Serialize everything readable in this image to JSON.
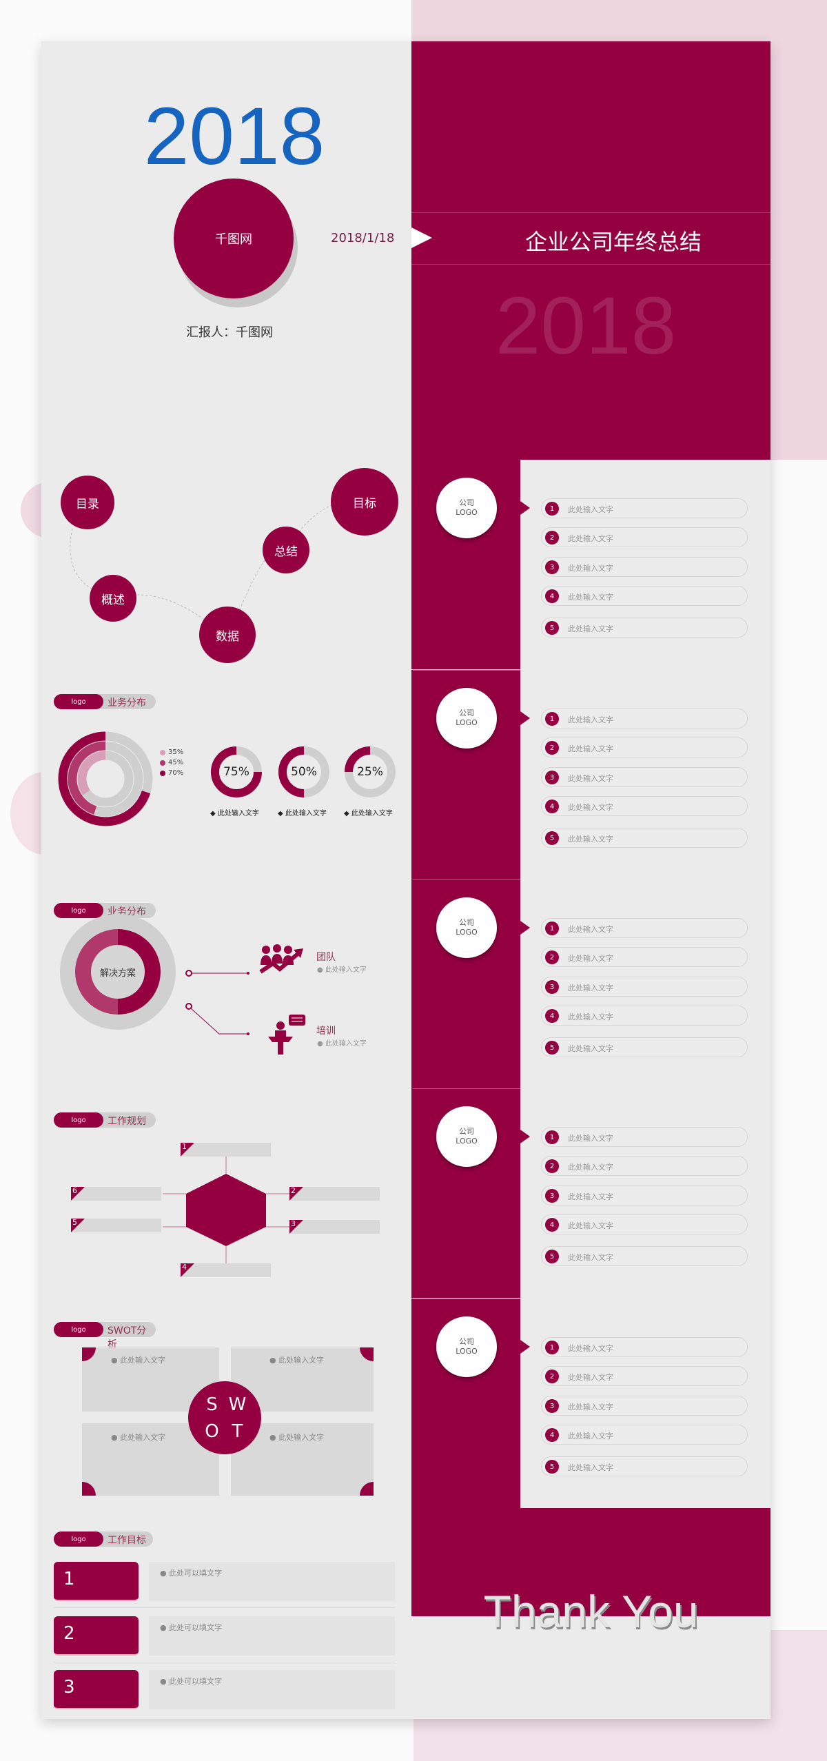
{
  "colors": {
    "accent": "#940040",
    "year_blue": "#1565c0",
    "panel": "#ebebeb"
  },
  "cover": {
    "year": "2018",
    "circle_label": "千图网",
    "date": "2018/1/18",
    "title": "企业公司年终总结",
    "reporter": "汇报人：千图网",
    "faded_year": "2018"
  },
  "toc": {
    "items": [
      "目录",
      "目标",
      "总结",
      "概述",
      "数据"
    ]
  },
  "dist1": {
    "logo": "logo",
    "title": "业务分布",
    "legend": [
      "35%",
      "45%",
      "70%"
    ],
    "rings": [
      35,
      45,
      70
    ],
    "donuts": [
      {
        "value": 75,
        "label": "75%",
        "caption": "◆ 此处输入文字"
      },
      {
        "value": 50,
        "label": "50%",
        "caption": "◆ 此处输入文字"
      },
      {
        "value": 25,
        "label": "25%",
        "caption": "◆ 此处输入文字"
      }
    ]
  },
  "dist2": {
    "logo": "logo",
    "title": "业务分布",
    "center": "解决方案",
    "items": [
      {
        "title": "团队",
        "text": "● 此处输入文字",
        "icon": "team-growth-icon"
      },
      {
        "title": "培训",
        "text": "● 此处输入文字",
        "icon": "presenter-icon"
      }
    ]
  },
  "plan": {
    "logo": "logo",
    "title": "工作规划",
    "numbers": [
      "1",
      "2",
      "3",
      "4",
      "5",
      "6"
    ]
  },
  "swot": {
    "logo": "logo",
    "title": "SWOT分析",
    "letters": [
      "S",
      "W",
      "O",
      "T"
    ],
    "texts": [
      "● 此处输入文字",
      "● 此处输入文字",
      "● 此处输入文字",
      "● 此处输入文字"
    ]
  },
  "goals": {
    "logo": "logo",
    "title": "工作目标",
    "items": [
      {
        "num": "1",
        "text": "● 此处可以填文字"
      },
      {
        "num": "2",
        "text": "● 此处可以填文字"
      },
      {
        "num": "3",
        "text": "● 此处可以填文字"
      }
    ]
  },
  "outline": {
    "sections": [
      {
        "logo": "公司\nLOGO",
        "items": [
          "此处输入文字",
          "此处输入文字",
          "此处输入文字",
          "此处输入文字",
          "此处输入文字"
        ]
      },
      {
        "logo": "公司\nLOGO",
        "items": [
          "此处输入文字",
          "此处输入文字",
          "此处输入文字",
          "此处输入文字",
          "此处输入文字"
        ]
      },
      {
        "logo": "公司\nLOGO",
        "items": [
          "此处输入文字",
          "此处输入文字",
          "此处输入文字",
          "此处输入文字",
          "此处输入文字"
        ]
      },
      {
        "logo": "公司\nLOGO",
        "items": [
          "此处输入文字",
          "此处输入文字",
          "此处输入文字",
          "此处输入文字",
          "此处输入文字"
        ]
      },
      {
        "logo": "公司\nLOGO",
        "items": [
          "此处输入文字",
          "此处输入文字",
          "此处输入文字",
          "此处输入文字",
          "此处输入文字"
        ]
      }
    ]
  },
  "closing": {
    "text": "Thank You"
  }
}
